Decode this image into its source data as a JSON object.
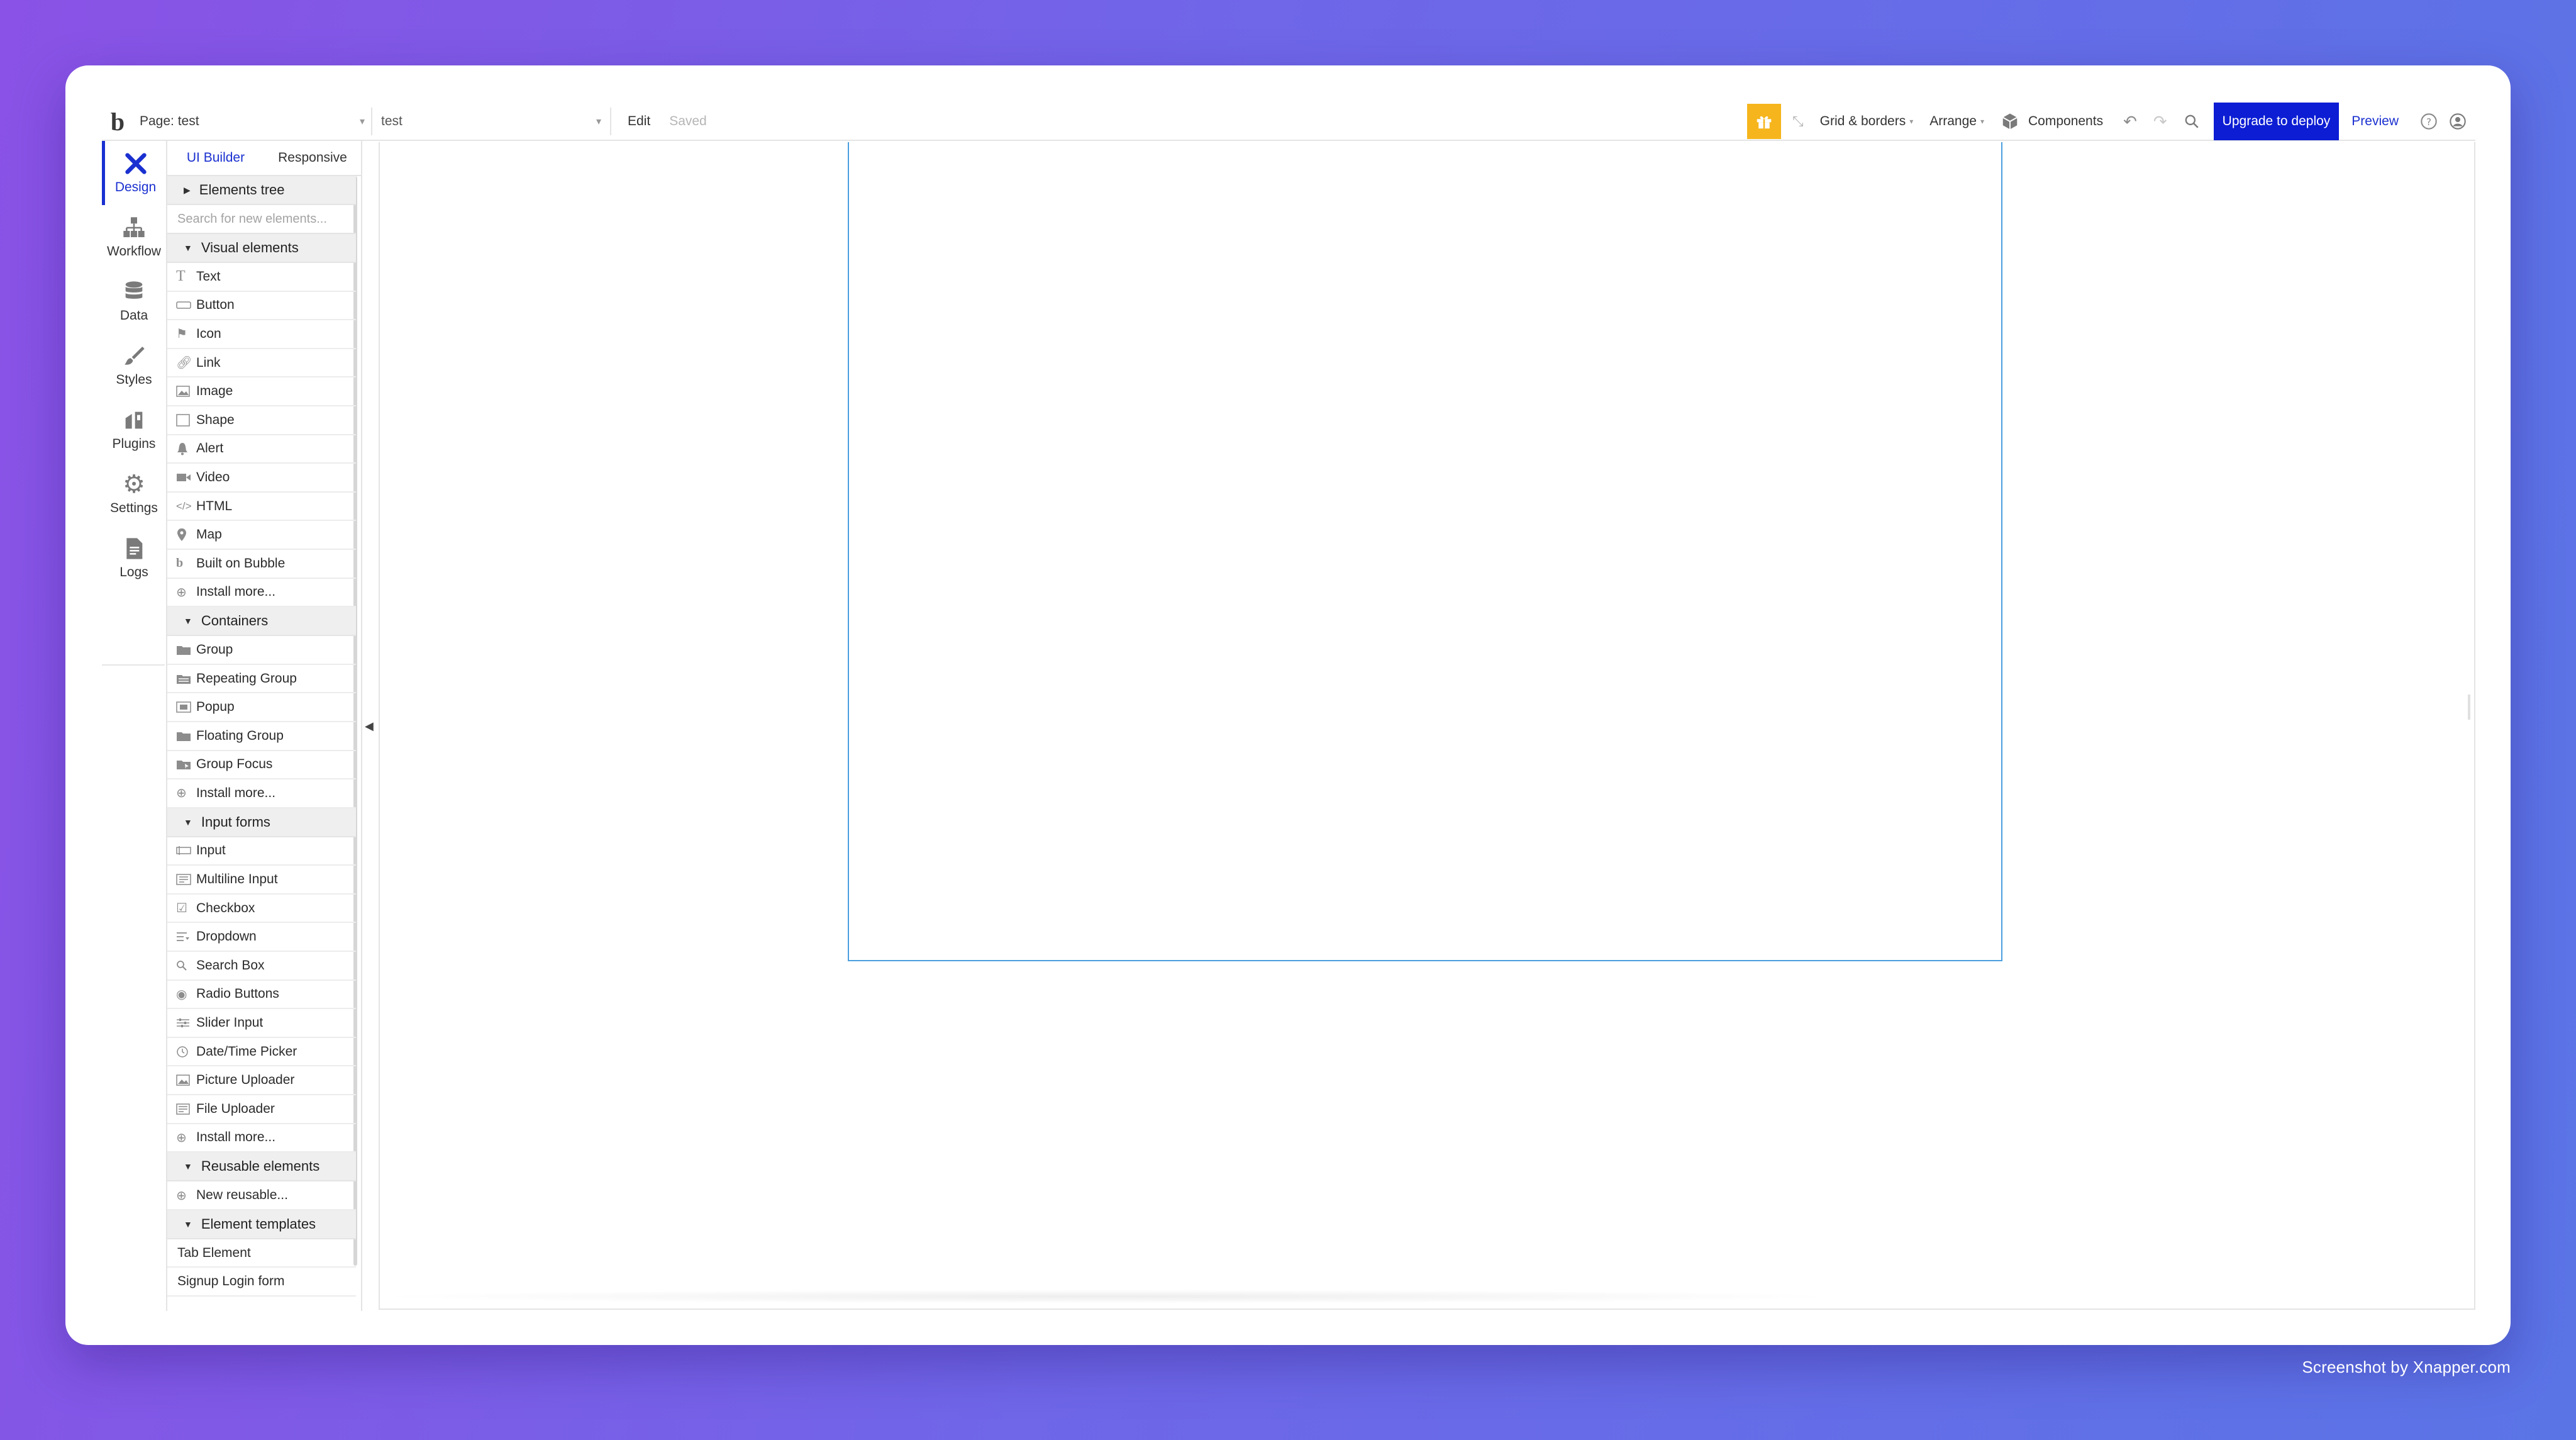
{
  "topbar": {
    "page_label": "Page: test",
    "version_label": "test",
    "edit_label": "Edit",
    "saved_label": "Saved",
    "grid_borders_label": "Grid & borders",
    "arrange_label": "Arrange",
    "components_label": "Components",
    "upgrade_label": "Upgrade to deploy",
    "preview_label": "Preview"
  },
  "rail": {
    "items": [
      {
        "label": "Design"
      },
      {
        "label": "Workflow"
      },
      {
        "label": "Data"
      },
      {
        "label": "Styles"
      },
      {
        "label": "Plugins"
      },
      {
        "label": "Settings"
      },
      {
        "label": "Logs"
      }
    ]
  },
  "panel": {
    "tabs": [
      {
        "label": "UI Builder"
      },
      {
        "label": "Responsive"
      }
    ],
    "elements_tree": "Elements tree",
    "search_placeholder": "Search for new elements...",
    "sections": {
      "visual": {
        "title": "Visual elements",
        "items": [
          "Text",
          "Button",
          "Icon",
          "Link",
          "Image",
          "Shape",
          "Alert",
          "Video",
          "HTML",
          "Map",
          "Built on Bubble",
          "Install more..."
        ]
      },
      "containers": {
        "title": "Containers",
        "items": [
          "Group",
          "Repeating Group",
          "Popup",
          "Floating Group",
          "Group Focus",
          "Install more..."
        ]
      },
      "inputs": {
        "title": "Input forms",
        "items": [
          "Input",
          "Multiline Input",
          "Checkbox",
          "Dropdown",
          "Search Box",
          "Radio Buttons",
          "Slider Input",
          "Date/Time Picker",
          "Picture Uploader",
          "File Uploader",
          "Install more..."
        ]
      },
      "reusable": {
        "title": "Reusable elements",
        "items": [
          "New reusable..."
        ]
      },
      "templates": {
        "title": "Element templates",
        "items": [
          "Tab Element",
          "Signup Login form"
        ]
      }
    }
  },
  "credit": "Screenshot by Xnapper.com"
}
